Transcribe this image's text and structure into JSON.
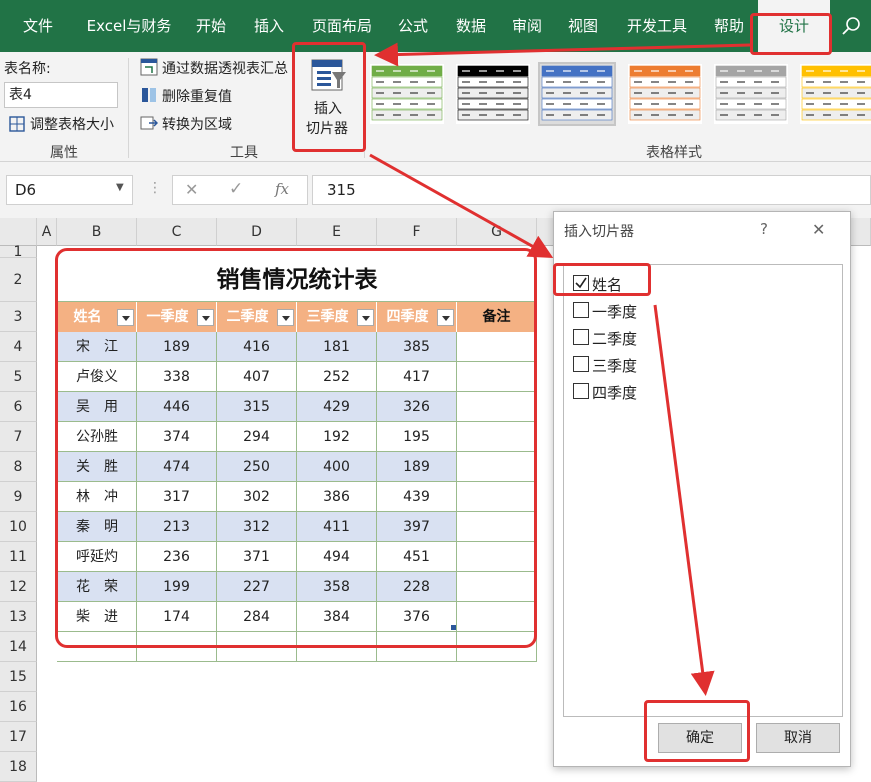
{
  "tabs": [
    "文件",
    "Excel与财务",
    "开始",
    "插入",
    "页面布局",
    "公式",
    "数据",
    "审阅",
    "视图",
    "开发工具",
    "帮助",
    "设计"
  ],
  "ribbon": {
    "table_name_label": "表名称:",
    "table_name_value": "表4",
    "resize_table": "调整表格大小",
    "group_properties": "属性",
    "tools": [
      "通过数据透视表汇总",
      "删除重复值",
      "转换为区域"
    ],
    "group_tools": "工具",
    "insert_slicer_line1": "插入",
    "insert_slicer_line2": "切片器",
    "group_styles": "表格样式",
    "style_colors": [
      "#70ad47",
      "#000000",
      "#4472c4",
      "#ed7d31",
      "#a5a5a5",
      "#ffc000"
    ]
  },
  "formula_bar": {
    "cell_ref": "D6",
    "cancel_glyph": "✕",
    "enter_glyph": "✓",
    "fx": "fx",
    "value": "315"
  },
  "grid": {
    "columns": [
      "A",
      "B",
      "C",
      "D",
      "E",
      "F",
      "G"
    ],
    "rows": [
      "1",
      "2",
      "3",
      "4",
      "5",
      "6",
      "7",
      "8",
      "9",
      "10",
      "11",
      "12",
      "13",
      "14",
      "15",
      "16",
      "17",
      "18"
    ]
  },
  "table": {
    "title": "销售情况统计表",
    "headers": [
      "姓名",
      "一季度",
      "二季度",
      "三季度",
      "四季度",
      "备注"
    ],
    "rows": [
      [
        "宋　江",
        "189",
        "416",
        "181",
        "385"
      ],
      [
        "卢俊义",
        "338",
        "407",
        "252",
        "417"
      ],
      [
        "吴　用",
        "446",
        "315",
        "429",
        "326"
      ],
      [
        "公孙胜",
        "374",
        "294",
        "192",
        "195"
      ],
      [
        "关　胜",
        "474",
        "250",
        "400",
        "189"
      ],
      [
        "林　冲",
        "317",
        "302",
        "386",
        "439"
      ],
      [
        "秦　明",
        "213",
        "312",
        "411",
        "397"
      ],
      [
        "呼延灼",
        "236",
        "371",
        "494",
        "451"
      ],
      [
        "花　荣",
        "199",
        "227",
        "358",
        "228"
      ],
      [
        "柴　进",
        "174",
        "284",
        "384",
        "376"
      ]
    ]
  },
  "dialog": {
    "title": "插入切片器",
    "help": "?",
    "close": "✕",
    "fields": [
      {
        "label": "姓名",
        "checked": true
      },
      {
        "label": "一季度",
        "checked": false
      },
      {
        "label": "二季度",
        "checked": false
      },
      {
        "label": "三季度",
        "checked": false
      },
      {
        "label": "四季度",
        "checked": false
      }
    ],
    "ok": "确定",
    "cancel": "取消"
  }
}
